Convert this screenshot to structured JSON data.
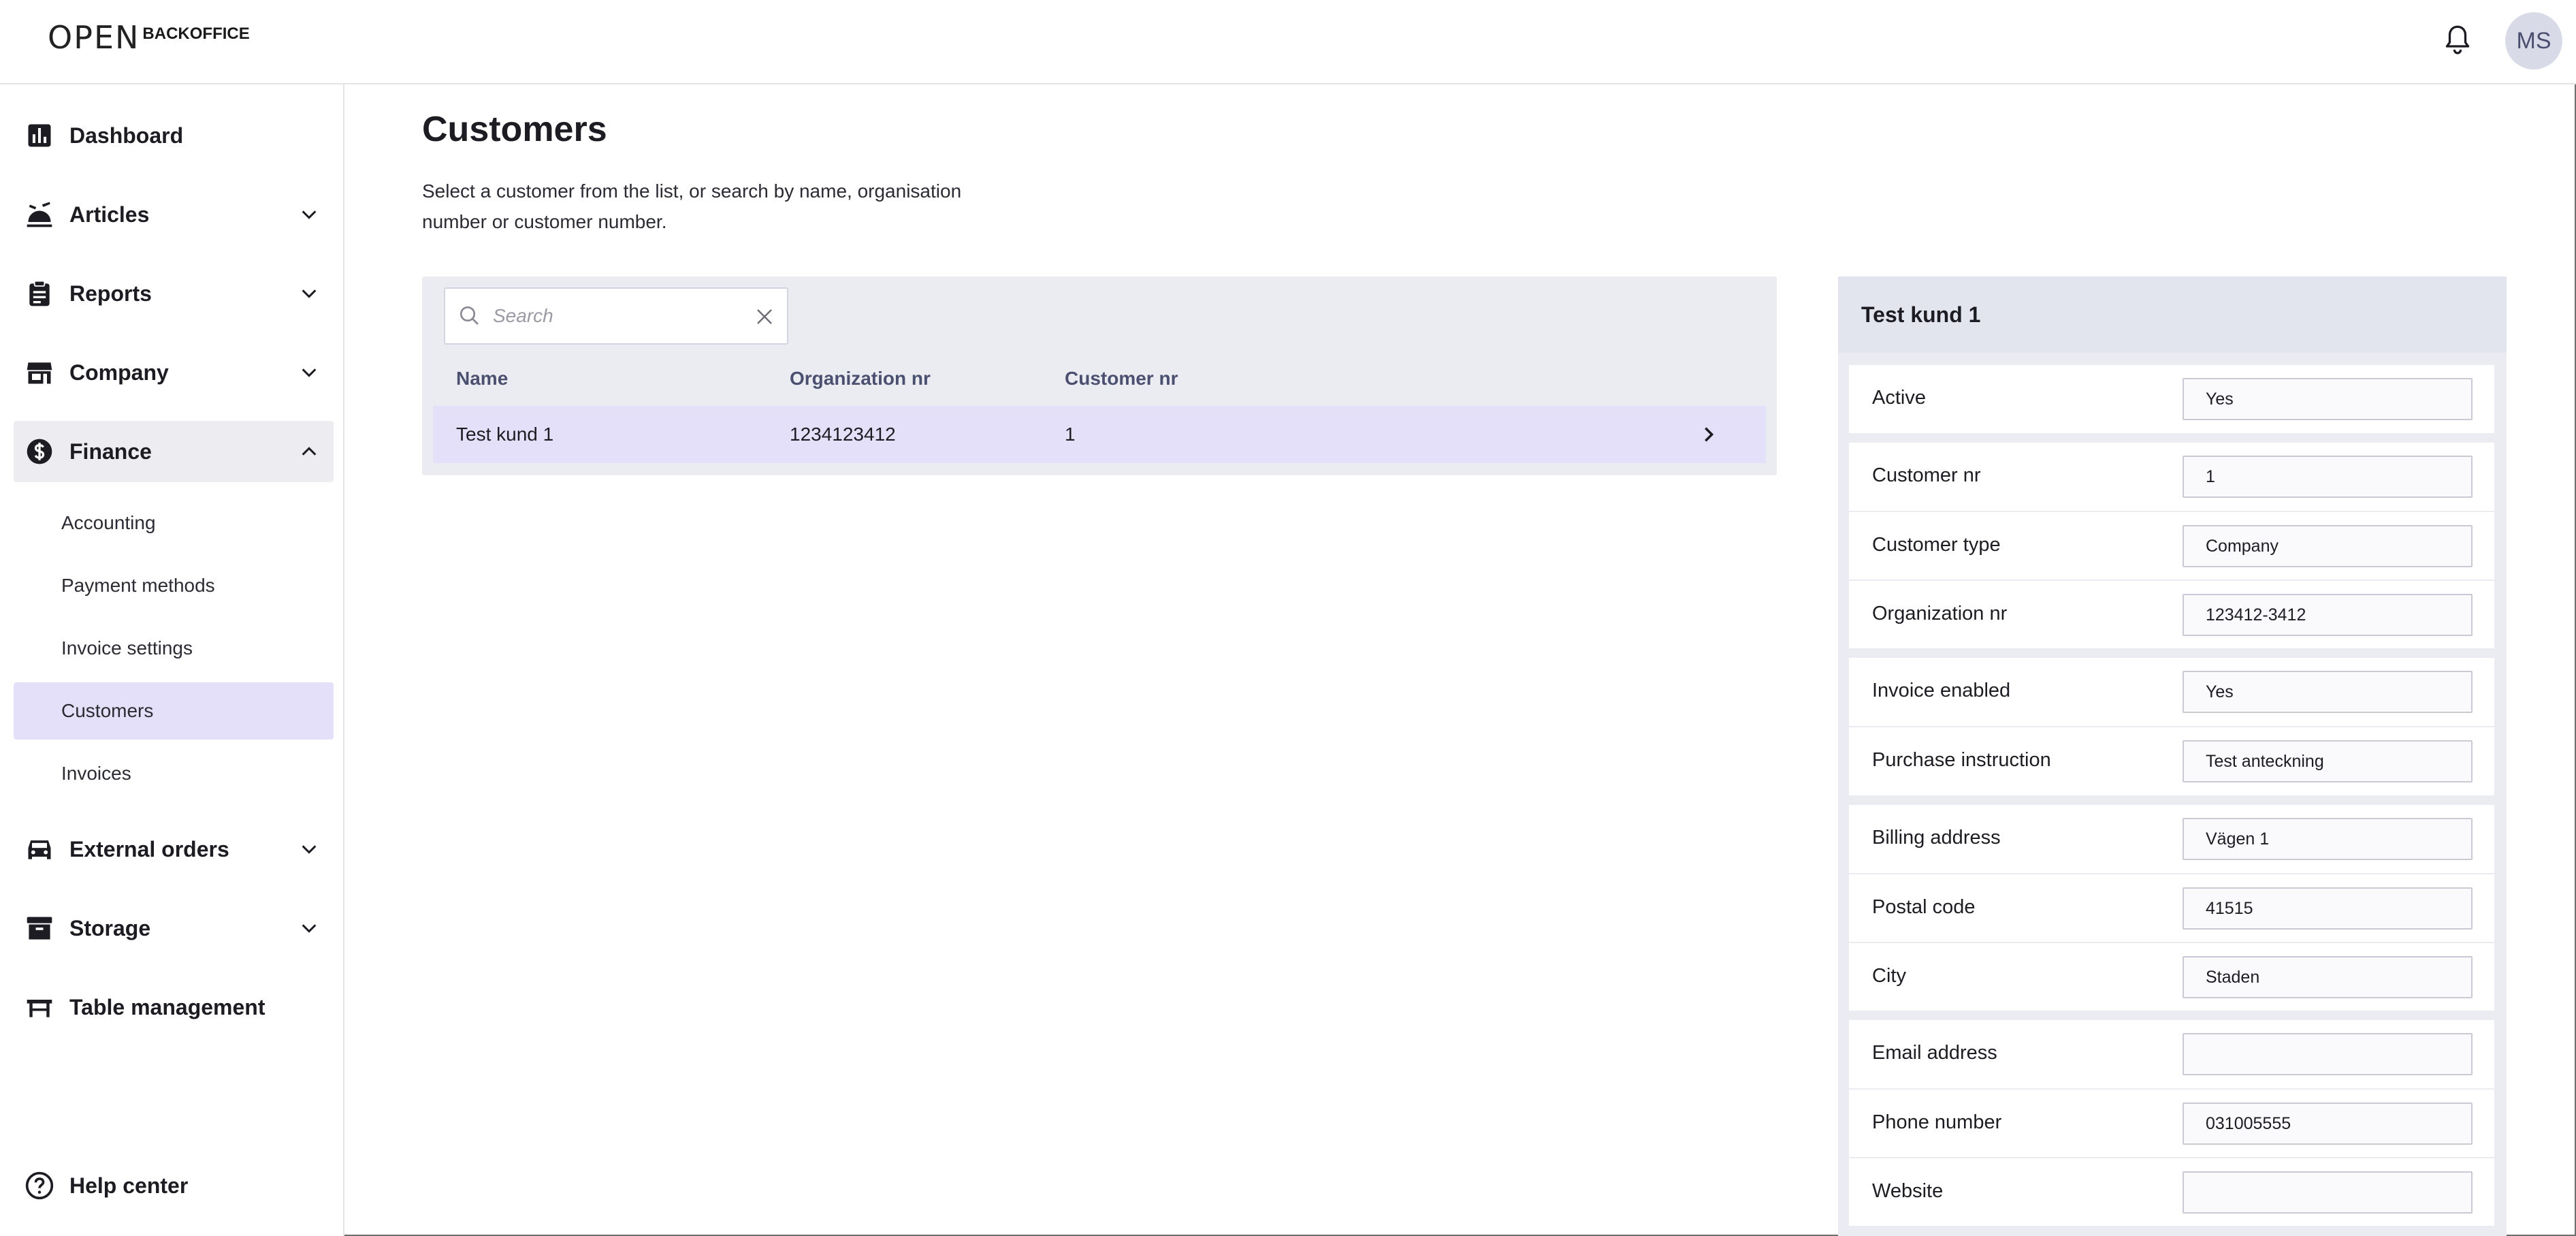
{
  "header": {
    "logo_mark": "OPEN",
    "logo_text": "BACKOFFICE",
    "avatar_initials": "MS"
  },
  "sidebar": {
    "items": [
      {
        "label": "Dashboard",
        "icon": "bar-chart-icon"
      },
      {
        "label": "Articles",
        "icon": "food-icon",
        "expandable": true
      },
      {
        "label": "Reports",
        "icon": "clipboard-icon",
        "expandable": true
      },
      {
        "label": "Company",
        "icon": "store-icon",
        "expandable": true
      },
      {
        "label": "Finance",
        "icon": "dollar-icon",
        "expandable": true,
        "expanded": true
      },
      {
        "label": "External orders",
        "icon": "car-icon",
        "expandable": true
      },
      {
        "label": "Storage",
        "icon": "archive-icon",
        "expandable": true
      },
      {
        "label": "Table management",
        "icon": "table-icon"
      }
    ],
    "finance_sub": [
      {
        "label": "Accounting"
      },
      {
        "label": "Payment methods"
      },
      {
        "label": "Invoice settings"
      },
      {
        "label": "Customers",
        "active": true
      },
      {
        "label": "Invoices"
      }
    ],
    "help": "Help center"
  },
  "main": {
    "title": "Customers",
    "description": "Select a customer from the list, or search by name, organisation number or customer number.",
    "search_placeholder": "Search",
    "columns": [
      "Name",
      "Organization nr",
      "Customer nr"
    ],
    "rows": [
      {
        "name": "Test kund 1",
        "org": "1234123412",
        "cust": "1"
      }
    ]
  },
  "detail": {
    "title": "Test kund 1",
    "fields": [
      {
        "label": "Active",
        "value": "Yes"
      },
      {
        "label": "Customer nr",
        "value": "1"
      },
      {
        "label": "Customer type",
        "value": "Company"
      },
      {
        "label": "Organization nr",
        "value": "123412-3412"
      },
      {
        "label": "Invoice enabled",
        "value": "Yes"
      },
      {
        "label": "Purchase instruction",
        "value": "Test anteckning"
      },
      {
        "label": "Billing address",
        "value": "Vägen 1"
      },
      {
        "label": "Postal code",
        "value": "41515"
      },
      {
        "label": "City",
        "value": "Staden"
      },
      {
        "label": "Email address",
        "value": ""
      },
      {
        "label": "Phone number",
        "value": "031005555"
      },
      {
        "label": "Website",
        "value": ""
      }
    ]
  },
  "colors": {
    "accent_bg": "#e4e0fa",
    "panel_bg": "#ebecf2",
    "avatar_bg": "#d9dae8"
  }
}
